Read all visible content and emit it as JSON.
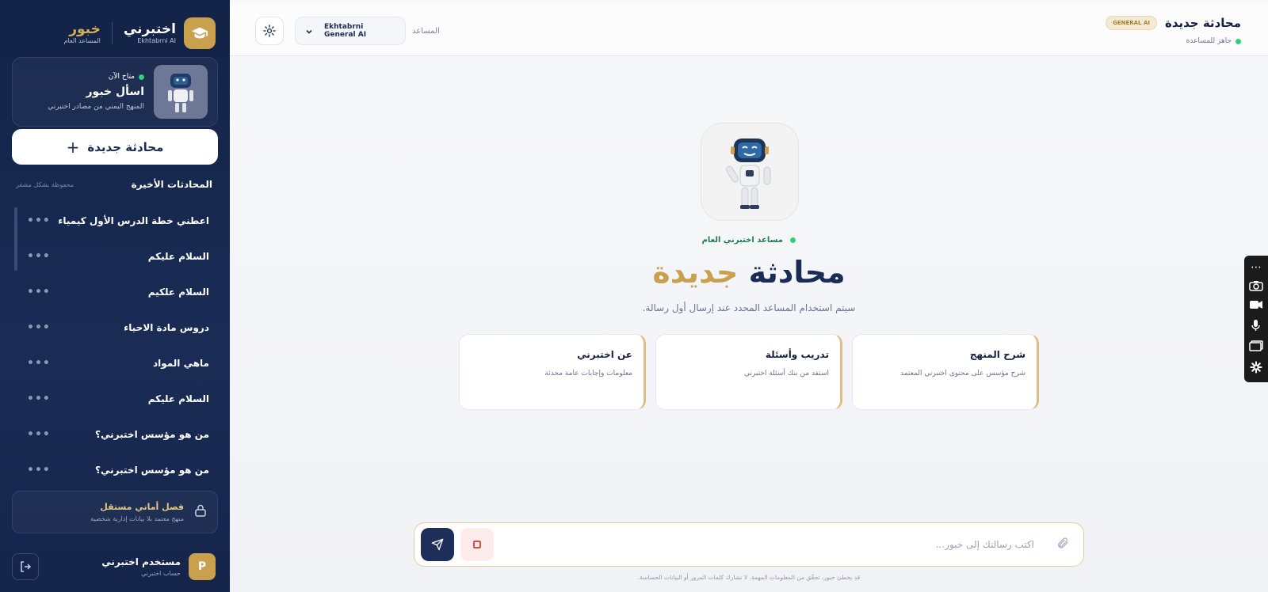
{
  "sidebar": {
    "brand": {
      "name": "اختبرني",
      "sub": "Ekhtabrni AI"
    },
    "brand2": {
      "name": "خبور",
      "sub": "المساعد العام"
    },
    "hero": {
      "status": "متاح الآن",
      "title": "اسأل خبور",
      "subtitle": "المنهج اليمني من مصادر اختبرني"
    },
    "new_chat_label": "محادثة جديدة",
    "recent_title": "المحادثات الأخيرة",
    "recent_note": "محفوظة بشكل مشفر",
    "chats": [
      "اعطني خطة الدرس الأول كيمياء",
      "السلام عليكم",
      "السلام علكيم",
      "دروس مادة الاحياء",
      "ماهي المواد",
      "السلام عليكم",
      "من هو مؤسس اختبرني؟",
      "من هو مؤسس اختبرني؟"
    ],
    "locked": {
      "title": "فصل أماني مستقل",
      "subtitle": "منهج معتمد بلا بيانات إدارية شخصية"
    },
    "user": {
      "initial": "P",
      "name": "مستخدم اختبرني",
      "sub": "حساب اختبرني"
    }
  },
  "topbar": {
    "title": "محادثة جديدة",
    "badge": "GENERAL AI",
    "status": "جاهز للمساعدة",
    "model_label": "المساعد",
    "model_value": "Ekhtabrni General AI"
  },
  "main": {
    "assistant_tag": "مساعد اختبرني العام",
    "title_part1": "محادثة",
    "title_part2": "جديدة",
    "subtitle": "سيتم استخدام المساعد المحدد عند إرسال أول رسالة.",
    "cards": [
      {
        "title": "عن اختبرني",
        "desc": "معلومات وإجابات عامة محدثة"
      },
      {
        "title": "تدريب وأسئلة",
        "desc": "استفد من بنك أسئلة اختبرني"
      },
      {
        "title": "شرح المنهج",
        "desc": "شرح مؤسس على محتوى اختبرني المعتمد"
      }
    ],
    "composer": {
      "placeholder": "اكتب رسالتك إلى خبور...",
      "value": ""
    },
    "disclaimer": "قد يخطئ خبور، تحقّق من المعلومات المهمة. لا تشارك كلمات المرور أو البيانات الحساسة."
  },
  "colors": {
    "navy": "#132347",
    "gold": "#c9a14e",
    "status_green": "#2ed07a",
    "stop_red": "#e04b45"
  }
}
